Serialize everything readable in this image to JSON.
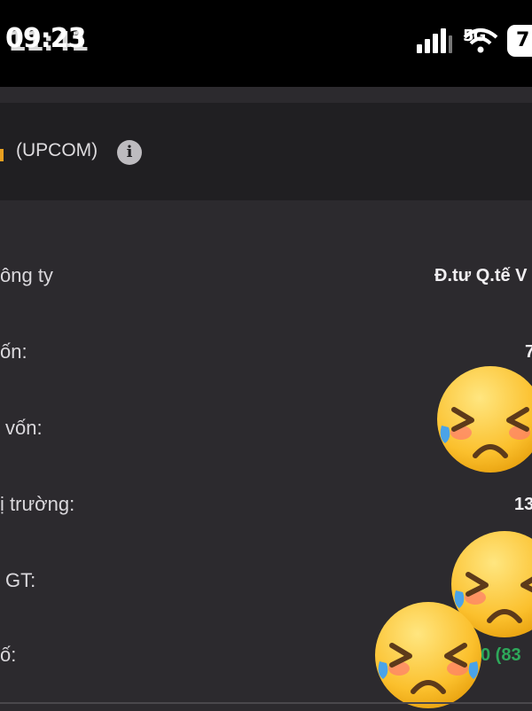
{
  "status_bar": {
    "time": "11:41",
    "time_overlay": "09:23",
    "network": "5G",
    "battery": "7"
  },
  "header": {
    "exchange": "(UPCOM)",
    "info_glyph": "i"
  },
  "rows": [
    {
      "label": "ông ty",
      "value": "Đ.tư Q.tế V"
    },
    {
      "label": "ốn:",
      "value": "7"
    },
    {
      "label": "vốn:",
      "value": ""
    },
    {
      "label": "ị trường:",
      "value": "13"
    },
    {
      "label": "GT:",
      "value": ""
    },
    {
      "label": "ố:",
      "value": "0 (83"
    }
  ],
  "emojis": [
    "crying-face",
    "crying-face",
    "crying-face"
  ],
  "colors": {
    "status_bar": "#000000",
    "header": "#201f22",
    "background": "#2c2a2e",
    "positive": "#2ea85a"
  }
}
